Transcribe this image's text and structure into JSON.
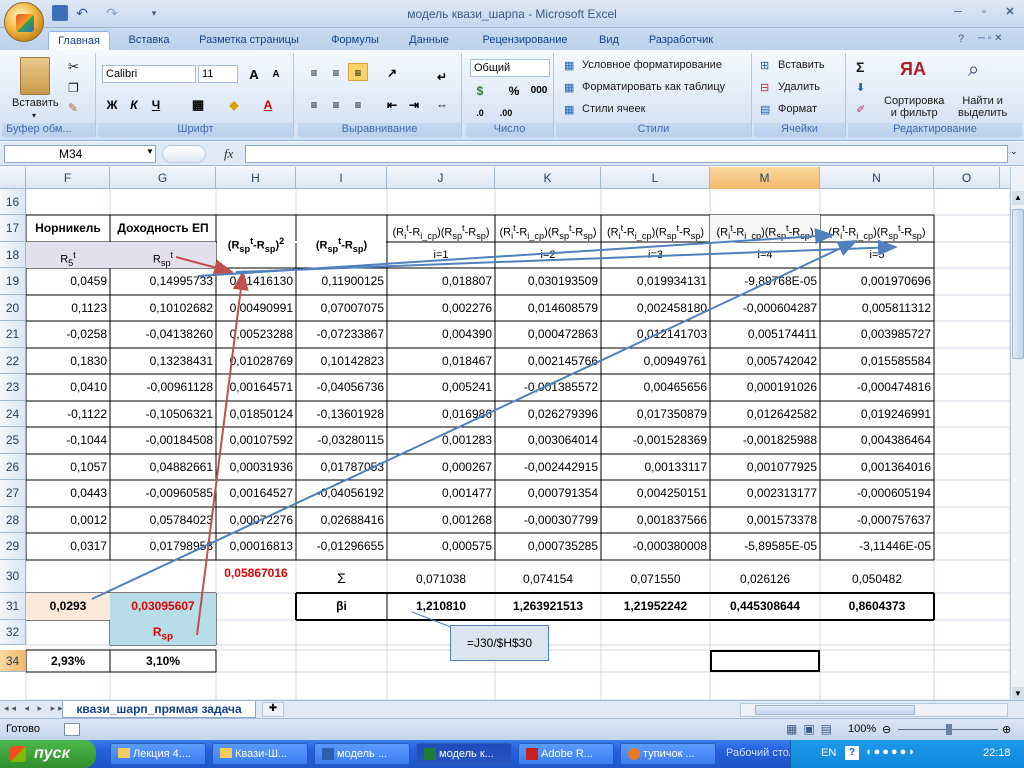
{
  "window": {
    "title": "модель квази_шарпа - Microsoft Excel"
  },
  "ribbon": {
    "tabs": [
      "Главная",
      "Вставка",
      "Разметка страницы",
      "Формулы",
      "Данные",
      "Рецензирование",
      "Вид",
      "Разработчик"
    ],
    "clipboard": {
      "paste_label": "Вставить",
      "group_label": "Буфер обм..."
    },
    "font": {
      "name": "Calibri",
      "size": "11",
      "bold": "Ж",
      "italic": "К",
      "underline": "Ч",
      "group_label": "Шрифт"
    },
    "alignment": {
      "group_label": "Выравнивание"
    },
    "number": {
      "format": "Общий",
      "percent": "%",
      "thousands": "000",
      "group_label": "Число"
    },
    "styles": {
      "conditional": "Условное форматирование",
      "as_table": "Форматировать как таблицу",
      "cell_styles": "Стили ячеек",
      "group_label": "Стили"
    },
    "cells": {
      "insert": "Вставить",
      "delete": "Удалить",
      "format": "Формат",
      "group_label": "Ячейки"
    },
    "editing": {
      "sigma": "Σ",
      "sort": "Сортировка\nи фильтр",
      "find": "Найти и\nвыделить",
      "group_label": "Редактирование"
    }
  },
  "formula_bar": {
    "cell_ref": "M34",
    "fx": "fx",
    "content": ""
  },
  "columns": [
    "F",
    "G",
    "H",
    "I",
    "J",
    "K",
    "L",
    "M",
    "N",
    "O"
  ],
  "rows": [
    "16",
    "17",
    "18",
    "19",
    "20",
    "21",
    "22",
    "23",
    "24",
    "25",
    "26",
    "27",
    "28",
    "29",
    "30",
    "31",
    "32",
    "34"
  ],
  "headers": {
    "nornickel": "Норникель",
    "r5t": "R5t",
    "dohod": "Доходность ЕП",
    "rspt": "Rspt",
    "h_hdr": "(Rspt-Rsp)²",
    "i_hdr": "(Rspt-Rsp)",
    "cov_hdr": "(Rit-Ri_ср)(Rspt-Rsp)",
    "i_labels": [
      "i=1",
      "i=2",
      "i=3",
      "i=4",
      "i=5"
    ]
  },
  "table": [
    [
      "0,0459",
      "0,14995733",
      "0,01416130",
      "0,11900125",
      "0,018807",
      "0,030193509",
      "0,019934131",
      "-9,89768E-05",
      "0,001970696"
    ],
    [
      "0,1123",
      "0,10102682",
      "0,00490991",
      "0,07007075",
      "0,002276",
      "0,014608579",
      "0,002458180",
      "-0,000604287",
      "0,005811312"
    ],
    [
      "-0,0258",
      "-0,04138260",
      "0,00523288",
      "-0,07233867",
      "0,004390",
      "0,000472863",
      "0,012141703",
      "0,005174411",
      "0,003985727"
    ],
    [
      "0,1830",
      "0,13238431",
      "0,01028769",
      "0,10142823",
      "0,018467",
      "0,002145766",
      "0,00949761",
      "0,005742042",
      "0,015585584"
    ],
    [
      "0,0410",
      "-0,00961128",
      "0,00164571",
      "-0,04056736",
      "0,005241",
      "-0,001385572",
      "0,00465656",
      "0,000191026",
      "-0,000474816"
    ],
    [
      "-0,1122",
      "-0,10506321",
      "0,01850124",
      "-0,13601928",
      "0,016986",
      "0,026279396",
      "0,017350879",
      "0,012642582",
      "0,019246991"
    ],
    [
      "-0,1044",
      "-0,00184508",
      "0,00107592",
      "-0,03280115",
      "0,001283",
      "0,003064014",
      "-0,001528369",
      "-0,001825988",
      "0,004386464"
    ],
    [
      "0,1057",
      "0,04882661",
      "0,00031936",
      "0,01787053",
      "0,000267",
      "-0,002442915",
      "0,00133117",
      "0,001077925",
      "0,001364016"
    ],
    [
      "0,0443",
      "-0,00960585",
      "0,00164527",
      "-0,04056192",
      "0,001477",
      "0,000791354",
      "0,004250151",
      "0,002313177",
      "-0,000605194"
    ],
    [
      "0,0012",
      "0,05784023",
      "0,00072276",
      "0,02688416",
      "0,001268",
      "-0,000307799",
      "0,001837566",
      "0,001573378",
      "-0,000757637"
    ],
    [
      "0,0317",
      "0,01798953",
      "0,00016813",
      "-0,01296655",
      "0,000575",
      "0,000735285",
      "-0,000380008",
      "-5,89585E-05",
      "-3,11446E-05"
    ]
  ],
  "row30": {
    "h": "0,05867016",
    "sigma": "Σ",
    "j": "0,071038",
    "k": "0,074154",
    "l": "0,071550",
    "m": "0,026126",
    "n": "0,050482"
  },
  "row31": {
    "f": "0,0293",
    "g": "0,03095607",
    "i": "βi",
    "j": "1,210810",
    "k": "1,263921513",
    "l": "1,21952242",
    "m": "0,445308644",
    "n": "0,8604373"
  },
  "row32": {
    "g": "Rsp"
  },
  "row34": {
    "f": "2,93%",
    "g": "3,10%"
  },
  "callout": {
    "text": "=J30/$H$30"
  },
  "sheet_tab": "квази_шарп_прямая задача",
  "status": {
    "ready": "Готово",
    "zoom": "100%"
  },
  "taskbar": {
    "start": "пуск",
    "tasks": [
      "Лекция 4....",
      "Квази-Ш...",
      "модель ...",
      "модель к...",
      "Adobe R...",
      "тупичок ..."
    ],
    "desktop": "Рабочий стол",
    "lang": "EN",
    "clock": "22:18"
  },
  "colors": {
    "peach": "#fde9d9",
    "cyan": "#b7dee8",
    "lavender": "#e4dfec",
    "red": "#e00000",
    "arrow_red": "#c0504d",
    "arrow_blue": "#4f81bd"
  }
}
